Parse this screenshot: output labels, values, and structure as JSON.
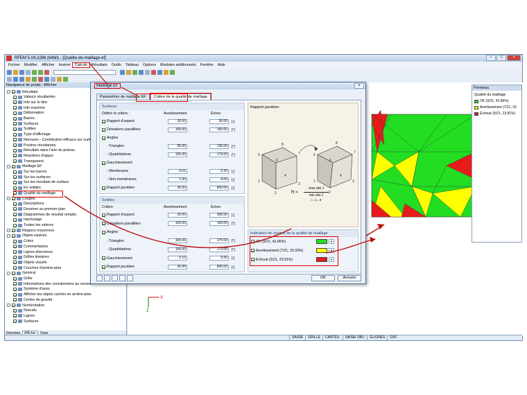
{
  "window": {
    "title": "RFEM 5.04.2288 (64bit) - [Qualite-de-maillage-ef]"
  },
  "menu": [
    "Fichier",
    "Modifier",
    "Afficher",
    "Insérer",
    "Calculs",
    "Résultats",
    "Outils",
    "Tableau",
    "Options",
    "Modules additionnels",
    "Fenêtre",
    "Aide"
  ],
  "navigator": {
    "title": "Navigateur de projet - Afficher",
    "rows": [
      {
        "label": "Résultats",
        "level": 0
      },
      {
        "label": "Valeurs résultantes",
        "level": 1
      },
      {
        "label": "Info sur le titre",
        "level": 1
      },
      {
        "label": "Info max/min",
        "level": 1
      },
      {
        "label": "Déformation",
        "level": 1
      },
      {
        "label": "Barres",
        "level": 1
      },
      {
        "label": "Surfaces",
        "level": 1
      },
      {
        "label": "Solides",
        "level": 1
      },
      {
        "label": "Type d'affichage",
        "level": 1
      },
      {
        "label": "Nervures - Contribution efficace sur surfa",
        "level": 1
      },
      {
        "label": "Poutres résultantes",
        "level": 1
      },
      {
        "label": "Résultats dans l'aire du poteau",
        "level": 1
      },
      {
        "label": "Réactions d'appui",
        "level": 1
      },
      {
        "label": "Transparent",
        "level": 1
      },
      {
        "label": "Maillage EF",
        "level": 0
      },
      {
        "label": "Sur les barres",
        "level": 1
      },
      {
        "label": "Sur les surfaces",
        "level": 1
      },
      {
        "label": "Sur les résultats de surface",
        "level": 1
      },
      {
        "label": "En solides",
        "level": 1
      },
      {
        "label": "Qualité du maillage",
        "level": 1
      },
      {
        "label": "Coupes",
        "level": 0
      },
      {
        "label": "Descriptions",
        "level": 1
      },
      {
        "label": "Dessiner au premier plan",
        "level": 1
      },
      {
        "label": "Diagrammes de résultat remplis",
        "level": 1
      },
      {
        "label": "Hachurage",
        "level": 1
      },
      {
        "label": "Toutes les valeurs",
        "level": 1
      },
      {
        "label": "Régions moyennes",
        "level": 0
      },
      {
        "label": "Objets repères",
        "level": 0
      },
      {
        "label": "Cotes",
        "level": 1
      },
      {
        "label": "Commentaires",
        "level": 1
      },
      {
        "label": "Lignes directrices",
        "level": 1
      },
      {
        "label": "Grilles linéaires",
        "level": 1
      },
      {
        "label": "Objets visuels",
        "level": 1
      },
      {
        "label": "Couches d'arrière-plan",
        "level": 1
      },
      {
        "label": "Général",
        "level": 0
      },
      {
        "label": "Grille",
        "level": 1
      },
      {
        "label": "Informations des coordonnées au curseur",
        "level": 1
      },
      {
        "label": "Système d'axes",
        "level": 1
      },
      {
        "label": "Afficher les objets cachés en arrière-plan",
        "level": 1
      },
      {
        "label": "Centre de gravité",
        "level": 1
      },
      {
        "label": "Numérotation",
        "level": 0
      },
      {
        "label": "Noeuds",
        "level": 1
      },
      {
        "label": "Lignes",
        "level": 1
      },
      {
        "label": "Surfaces",
        "level": 1
      }
    ],
    "tabs": [
      "Données",
      "Afficher",
      "Vues"
    ]
  },
  "dialog": {
    "title": "Maillage EF",
    "tabs": [
      "Paramètres de maillage EF",
      "Critère de la qualité de maillage"
    ],
    "surfaces": {
      "title": "Surfaces",
      "criteria_label": "Définir le critère :",
      "col_warn": "Avertissement",
      "col_fail": "Échec",
      "rows": [
        {
          "label": "Rapport d'aspect",
          "warn": "20.00",
          "fail": "30.00",
          "unit": "[-]"
        },
        {
          "label": "Déviations parallèles",
          "warn": "100.00",
          "fail": "160.00",
          "unit": "[°]"
        },
        {
          "label": "Angles",
          "warn": "",
          "fail": "",
          "unit": ""
        },
        {
          "label": "- Triangles",
          "warn": "95.00",
          "fail": "135.00",
          "unit": "[°]"
        },
        {
          "label": "- Quadrilatères",
          "warn": "155.00",
          "fail": "179.00",
          "unit": "[°]"
        },
        {
          "label": "Gauchissement",
          "warn": "",
          "fail": "",
          "unit": ""
        },
        {
          "label": "- Membranes",
          "warn": "0.01",
          "fail": "0.20",
          "unit": "[-]"
        },
        {
          "label": "- Non-membranes",
          "warn": "1.00",
          "fail": "4.00",
          "unit": "[-]"
        },
        {
          "label": "Rapport jacobien",
          "warn": "30.00",
          "fail": "800.00",
          "unit": "[-]"
        }
      ]
    },
    "solides": {
      "title": "Solides",
      "criteria_label": "Critère",
      "col_warn": "Avertissement",
      "col_fail": "Échec",
      "rows": [
        {
          "label": "Rapport d'aspect",
          "warn": "20.00",
          "fail": "300.00",
          "unit": "[-]"
        },
        {
          "label": "Déviations parallèles",
          "warn": "100.00",
          "fail": "160.00",
          "unit": "[°]"
        },
        {
          "label": "Angles",
          "warn": "",
          "fail": "",
          "unit": ""
        },
        {
          "label": "- Triangles",
          "warn": "105.00",
          "fail": "175.00",
          "unit": "[°]"
        },
        {
          "label": "- Quadrilatères",
          "warn": "155.00",
          "fail": "179.00",
          "unit": "[°]"
        },
        {
          "label": "Gauchissement",
          "warn": "0.10",
          "fail": "0.50",
          "unit": "[-]"
        },
        {
          "label": "Rapport jacobien",
          "warn": "30.00",
          "fail": "800.00",
          "unit": "[-]"
        }
      ]
    },
    "jacobian": {
      "title": "Rapport jacobien",
      "formula": "R = max det J / min det J",
      "formula_num": "max det J",
      "formula_den": "min det J",
      "formula_sub": "i = 1...8"
    },
    "indication": {
      "title": "Indication de couleur de la qualité de maillage",
      "rows": [
        {
          "label": "OK (9/21, 42.86%)",
          "color": "#22dd22"
        },
        {
          "label": "Avertissement (7/21, 33.33%)",
          "color": "#ffff00"
        },
        {
          "label": "Échoué (5/21, 23.81%)",
          "color": "#e81b1b"
        }
      ]
    },
    "ok_label": "OK",
    "cancel_label": "Annuler"
  },
  "panel": {
    "title": "Panneau",
    "subtitle": "Qualité du maillage",
    "items": [
      {
        "label": "OK (9/21, 42.86%)",
        "color": "#22dd22"
      },
      {
        "label": "Avertissement (7/21, 33",
        "color": "#ffff00"
      },
      {
        "label": "Échoué (5/21, 23.81%)",
        "color": "#e81b1b"
      }
    ]
  },
  "axes": {
    "x": "X",
    "z": "Z"
  },
  "status": [
    "SAISIE",
    "GRILLE",
    "CARTES.",
    "SAISIE OBJ.",
    "GLIGNES",
    "DXF"
  ]
}
